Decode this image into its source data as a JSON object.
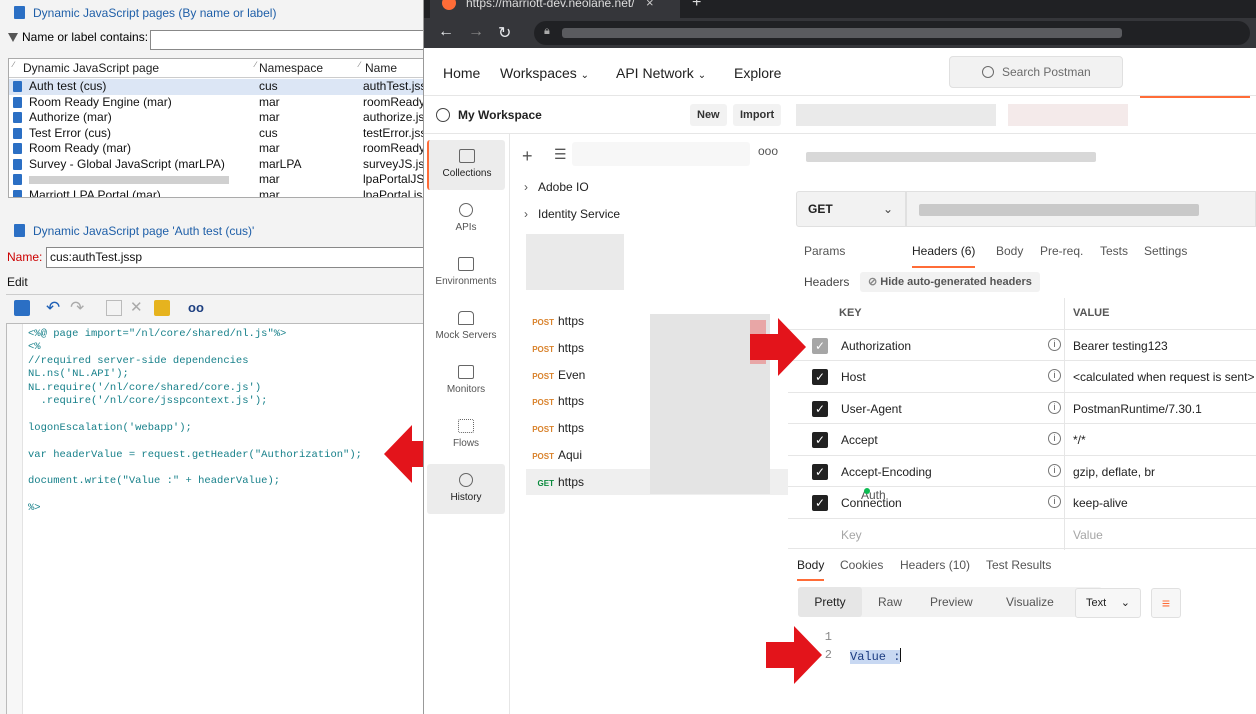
{
  "left_panel": {
    "list_title": "Dynamic JavaScript pages (By name or label)",
    "filter_label": "Name or label contains:",
    "filter_value": "",
    "columns": [
      "Dynamic JavaScript page",
      "Namespace",
      "Name"
    ],
    "rows": [
      {
        "label": "Auth test (cus)",
        "namespace": "cus",
        "name": "authTest.jssp"
      },
      {
        "label": "Room Ready Engine (mar)",
        "namespace": "mar",
        "name": "roomReadyE"
      },
      {
        "label": "Authorize (mar)",
        "namespace": "mar",
        "name": "authorize.jssp"
      },
      {
        "label": "Test Error (cus)",
        "namespace": "cus",
        "name": "testError.jssp"
      },
      {
        "label": "Room Ready (mar)",
        "namespace": "mar",
        "name": "roomReady.js"
      },
      {
        "label": "Survey - Global JavaScript (marLPA)",
        "namespace": "marLPA",
        "name": "surveyJS.jssp"
      },
      {
        "label": "",
        "namespace": "mar",
        "name": "lpaPortalJS.js"
      },
      {
        "label": "Marriott LPA Portal (mar)",
        "namespace": "mar",
        "name": "lpaPortal.jssp"
      }
    ],
    "detail_title": "Dynamic JavaScript page 'Auth test (cus)'",
    "name_label": "Name:",
    "name_value": "cus:authTest.jssp",
    "edit_label": "Edit",
    "code_lines": [
      "<%@ page import=\"/nl/core/shared/nl.js\"%>",
      "<%",
      "//required server-side dependencies",
      "NL.ns('NL.API');",
      "NL.require('/nl/core/shared/core.js')",
      "  .require('/nl/core/jsspcontext.js');",
      "",
      "logonEscalation('webapp');",
      "",
      "var headerValue = request.getHeader(\"Authorization\");",
      "",
      "document.write(\"Value :\" + headerValue);",
      "",
      "%>"
    ]
  },
  "browser": {
    "tab_title": "https://marriott-dev.neolane.net/",
    "tab_close": "×",
    "new_tab": "+"
  },
  "postman": {
    "nav": [
      "Home",
      "Workspaces",
      "API Network",
      "Explore"
    ],
    "search_placeholder": "Search Postman",
    "workspace_name": "My Workspace",
    "new_label": "New",
    "import_label": "Import",
    "sidebar": [
      "Collections",
      "APIs",
      "Environments",
      "Mock Servers",
      "Monitors",
      "Flows",
      "History"
    ],
    "folders": [
      "Adobe IO",
      "Identity Service"
    ],
    "requests": [
      {
        "method": "POST",
        "label": "https"
      },
      {
        "method": "POST",
        "label": "https"
      },
      {
        "method": "POST",
        "label": "Even"
      },
      {
        "method": "POST",
        "label": "https"
      },
      {
        "method": "POST",
        "label": "https"
      },
      {
        "method": "POST",
        "label": "Aqui"
      },
      {
        "method": "GET",
        "label": "https"
      }
    ],
    "method": "GET",
    "request_tabs": [
      "Params",
      "Auth",
      "Headers (6)",
      "Body",
      "Pre-req.",
      "Tests",
      "Settings"
    ],
    "headers_label": "Headers",
    "hide_auto": "Hide auto-generated headers",
    "key_col": "KEY",
    "value_col": "VALUE",
    "headers": [
      {
        "key": "Authorization",
        "value": "Bearer testing123",
        "enabled": "disabled"
      },
      {
        "key": "Host",
        "value": "<calculated when request is sent>",
        "enabled": "on"
      },
      {
        "key": "User-Agent",
        "value": "PostmanRuntime/7.30.1",
        "enabled": "on"
      },
      {
        "key": "Accept",
        "value": "*/*",
        "enabled": "on"
      },
      {
        "key": "Accept-Encoding",
        "value": "gzip, deflate, br",
        "enabled": "on"
      },
      {
        "key": "Connection",
        "value": "keep-alive",
        "enabled": "on"
      }
    ],
    "key_placeholder": "Key",
    "value_placeholder": "Value",
    "response_tabs": [
      "Body",
      "Cookies",
      "Headers (10)",
      "Test Results"
    ],
    "view_modes": [
      "Pretty",
      "Raw",
      "Preview",
      "Visualize"
    ],
    "format": "Text",
    "response_lines": [
      {
        "num": "1",
        "text": ""
      },
      {
        "num": "2",
        "text": "Value :"
      }
    ]
  },
  "colors": {
    "accent": "#ff6c37",
    "arrow": "#e3141b",
    "link_blue": "#1f5fa8"
  },
  "icons": [
    "filter-icon",
    "page-icon",
    "undo-icon",
    "redo-icon",
    "copy-icon",
    "cut-icon",
    "paste-icon",
    "find-icon",
    "person-icon",
    "search-icon",
    "plus-icon",
    "chevron-right-icon",
    "info-icon",
    "check-icon",
    "wrap-icon"
  ]
}
